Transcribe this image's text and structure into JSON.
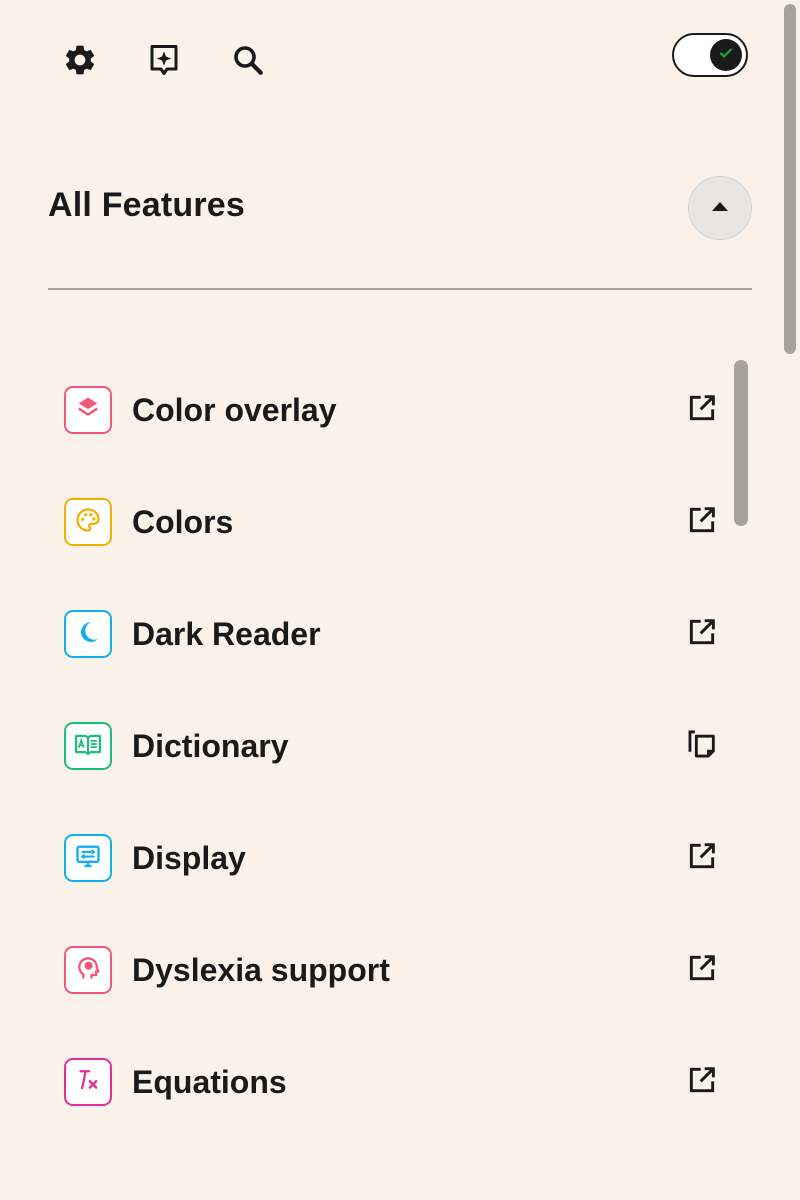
{
  "toolbar": {
    "icons": [
      "gear-icon",
      "sparkle-card-icon",
      "search-icon"
    ]
  },
  "toggle": {
    "state": "on",
    "accent": "#22A33A"
  },
  "section": {
    "title": "All Features",
    "collapse_icon": "caret-up-icon"
  },
  "features": [
    {
      "label": "Color overlay",
      "icon": "layers-icon",
      "color": "#F05A78",
      "action": "open-external"
    },
    {
      "label": "Colors",
      "icon": "palette-icon",
      "color": "#F4B000",
      "action": "open-external"
    },
    {
      "label": "Dark Reader",
      "icon": "moon-icon",
      "color": "#12AEEF",
      "action": "open-external"
    },
    {
      "label": "Dictionary",
      "icon": "book-icon",
      "color": "#1CBF7A",
      "action": "copy"
    },
    {
      "label": "Display",
      "icon": "monitor-icon",
      "color": "#12AEEF",
      "action": "open-external"
    },
    {
      "label": "Dyslexia support",
      "icon": "head-icon",
      "color": "#F05A78",
      "action": "open-external"
    },
    {
      "label": "Equations",
      "icon": "formula-icon",
      "color": "#E0309A",
      "action": "open-external"
    }
  ]
}
